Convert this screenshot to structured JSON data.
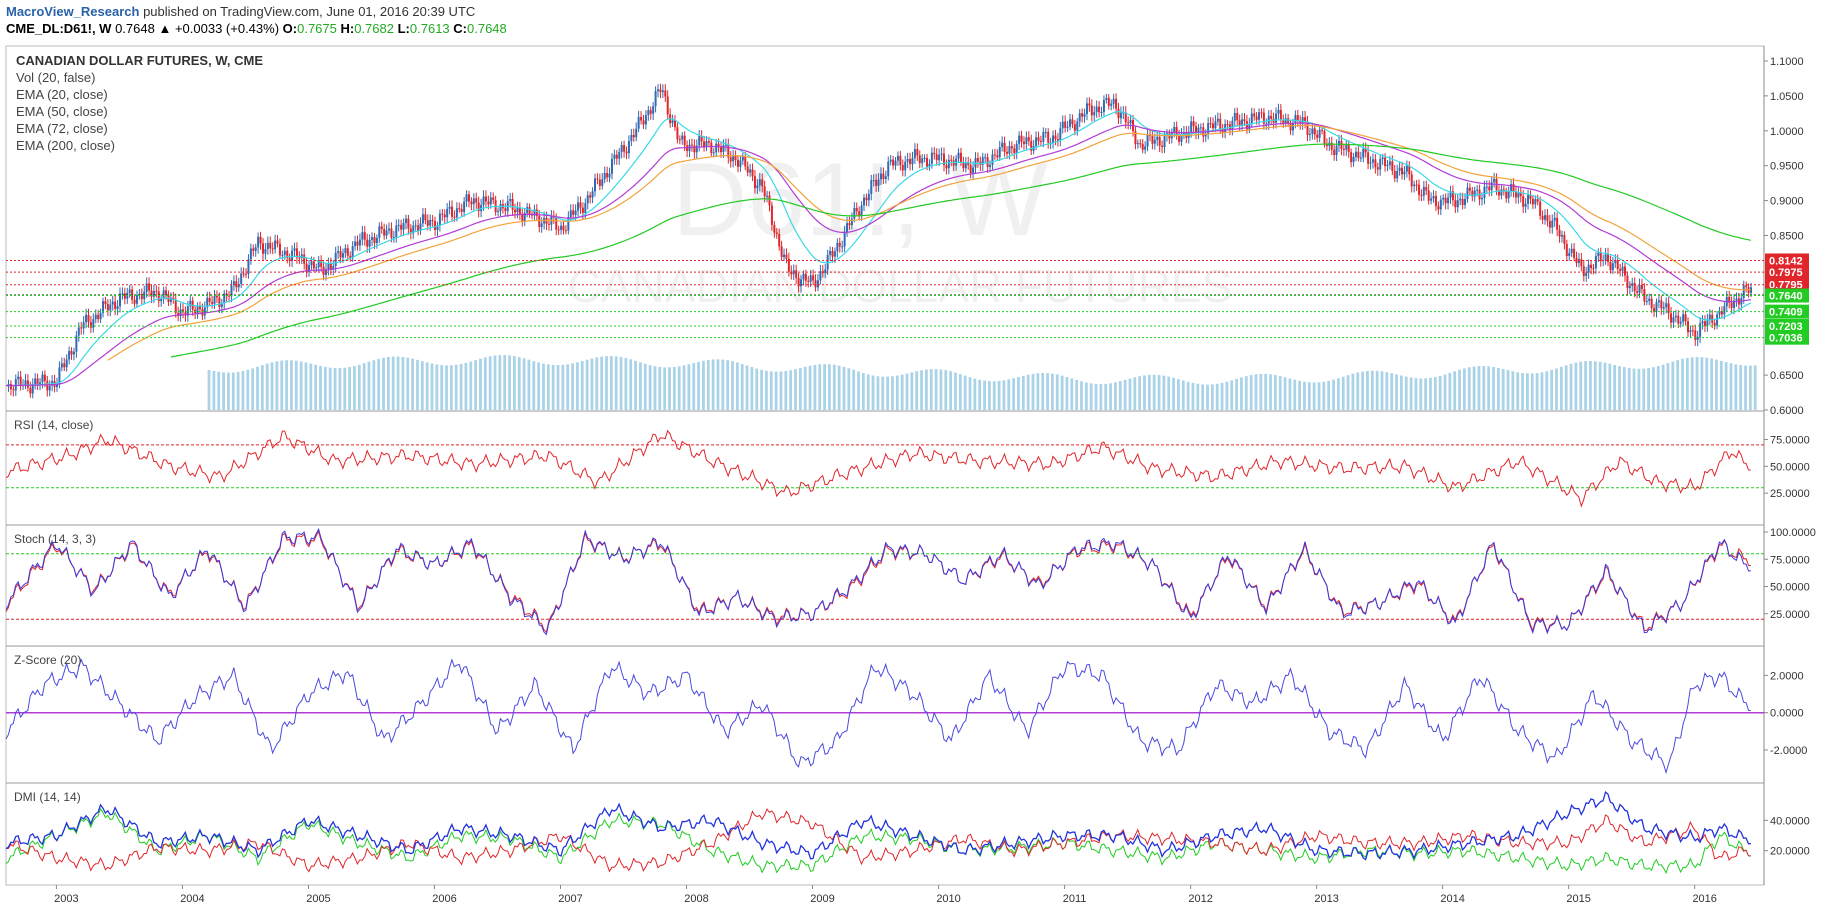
{
  "header": {
    "author": "MacroView_Research",
    "published": "published on TradingView.com, June 01, 2016 20:39 UTC",
    "symbol": "CME_DL:D61!, W",
    "last": "0.7648",
    "change": "▲ +0.0033 (+0.43%)",
    "o_label": "O:",
    "o_value": "0.7675",
    "h_label": "H:",
    "h_value": "0.7682",
    "l_label": "L:",
    "l_value": "0.7613",
    "c_label": "C:",
    "c_value": "0.7648"
  },
  "legend": {
    "title": "CANADIAN DOLLAR FUTURES, W, CME",
    "items": [
      "Vol (20, false)",
      "EMA (20, close)",
      "EMA (50, close)",
      "EMA (72, close)",
      "EMA (200, close)"
    ]
  },
  "watermark": {
    "symbol": "D61!, W",
    "name": "CANADIAN DOLLAR FUTURES"
  },
  "colors": {
    "candle_up": "#2f6ab3",
    "candle_down": "#e0262b",
    "ema20": "#3ad8e8",
    "ema50": "#b23bd6",
    "ema72": "#f2a33a",
    "ema200": "#22c922",
    "volume": "#8fc4e0",
    "resistance": "#e0262b",
    "support": "#22cc22",
    "rsi": "#e0262b",
    "stoch_k": "#3a3ae0",
    "stoch_d": "#e0262b",
    "zscore": "#4a4ae0",
    "zero_line": "#b23bd6",
    "dmi_plus": "#22cc22",
    "dmi_minus": "#e0262b",
    "adx": "#2233dd"
  },
  "chart_data": [
    {
      "type": "line",
      "panel": "price",
      "title": "CANADIAN DOLLAR FUTURES, W, CME",
      "ylim": [
        0.6,
        1.11
      ],
      "yticks": [
        "1.1000",
        "1.0500",
        "1.0000",
        "0.9500",
        "0.9000",
        "0.8500",
        "0.6500",
        "0.6000"
      ],
      "x_labels": [
        "2003",
        "2004",
        "2005",
        "2006",
        "2007",
        "2008",
        "2009",
        "2010",
        "2011",
        "2012",
        "2013",
        "2014",
        "2015",
        "2016"
      ],
      "series": [
        {
          "x": [
            2002.6,
            2003.0,
            2003.2,
            2003.5,
            2003.8,
            2004.0,
            2004.2,
            2004.4,
            2004.6,
            2004.9,
            2005.1,
            2005.4,
            2005.7,
            2006.0,
            2006.3,
            2006.6,
            2006.9,
            2007.0,
            2007.2,
            2007.4,
            2007.6,
            2007.8,
            2007.95,
            2008.2,
            2008.4,
            2008.6,
            2008.8,
            2009.0,
            2009.15,
            2009.4,
            2009.6,
            2009.8,
            2010.0,
            2010.3,
            2010.6,
            2010.9,
            2011.2,
            2011.4,
            2011.6,
            2011.8,
            2012.0,
            2012.3,
            2012.6,
            2012.9,
            2013.1,
            2013.4,
            2013.7,
            2013.9,
            2014.1,
            2014.4,
            2014.7,
            2014.9,
            2015.1,
            2015.3,
            2015.6,
            2015.8,
            2016.0,
            2016.2,
            2016.4
          ],
          "values": [
            0.635,
            0.64,
            0.72,
            0.76,
            0.77,
            0.74,
            0.75,
            0.77,
            0.84,
            0.82,
            0.8,
            0.84,
            0.86,
            0.87,
            0.9,
            0.89,
            0.87,
            0.86,
            0.9,
            0.95,
            1.0,
            1.06,
            0.98,
            0.98,
            0.96,
            0.92,
            0.8,
            0.78,
            0.82,
            0.9,
            0.95,
            0.96,
            0.96,
            0.95,
            0.98,
            0.99,
            1.03,
            1.04,
            0.98,
            0.99,
            1.0,
            1.01,
            1.02,
            1.01,
            0.98,
            0.96,
            0.94,
            0.9,
            0.9,
            0.92,
            0.9,
            0.86,
            0.8,
            0.82,
            0.76,
            0.74,
            0.71,
            0.74,
            0.77
          ]
        }
      ],
      "resistance_levels": [
        "0.8142",
        "0.7975",
        "0.7795"
      ],
      "current_level": "0.7648",
      "support_levels": [
        "0.7640",
        "0.7409",
        "0.7203",
        "0.7036"
      ]
    },
    {
      "type": "line",
      "panel": "rsi",
      "title": "RSI (14, close)",
      "yticks": [
        "75.0000",
        "50.0000",
        "25.0000"
      ],
      "ylim": [
        0,
        95
      ],
      "x": [
        2002.6,
        2003.1,
        2003.4,
        2003.9,
        2004.3,
        2004.8,
        2005.2,
        2005.8,
        2006.3,
        2006.9,
        2007.3,
        2007.8,
        2008.2,
        2008.8,
        2009.3,
        2009.8,
        2010.3,
        2010.9,
        2011.3,
        2011.7,
        2012.2,
        2012.7,
        2013.2,
        2013.7,
        2014.1,
        2014.6,
        2015.1,
        2015.4,
        2015.7,
        2016.0,
        2016.3,
        2016.4
      ],
      "values": [
        45,
        60,
        75,
        50,
        40,
        78,
        55,
        60,
        52,
        60,
        35,
        80,
        55,
        25,
        45,
        62,
        55,
        52,
        68,
        48,
        40,
        55,
        48,
        50,
        30,
        55,
        20,
        55,
        35,
        30,
        65,
        52
      ],
      "overbought": 70,
      "oversold": 30
    },
    {
      "type": "line",
      "panel": "stoch",
      "title": "Stoch (14, 3, 3)",
      "yticks": [
        "100.0000",
        "75.0000",
        "50.0000",
        "25.0000"
      ],
      "ylim": [
        0,
        100
      ],
      "x": [
        2002.6,
        2003.0,
        2003.3,
        2003.6,
        2003.9,
        2004.2,
        2004.5,
        2004.8,
        2005.1,
        2005.4,
        2005.7,
        2006.0,
        2006.3,
        2006.6,
        2006.9,
        2007.2,
        2007.5,
        2007.8,
        2008.1,
        2008.4,
        2008.7,
        2009.0,
        2009.3,
        2009.6,
        2009.9,
        2010.2,
        2010.5,
        2010.8,
        2011.1,
        2011.4,
        2011.7,
        2012.0,
        2012.3,
        2012.6,
        2012.9,
        2013.2,
        2013.5,
        2013.8,
        2014.1,
        2014.4,
        2014.7,
        2015.0,
        2015.3,
        2015.6,
        2015.9,
        2016.2,
        2016.4
      ],
      "values": [
        35,
        90,
        45,
        90,
        40,
        85,
        30,
        95,
        95,
        30,
        85,
        70,
        90,
        40,
        10,
        95,
        75,
        92,
        25,
        40,
        20,
        25,
        50,
        85,
        80,
        55,
        80,
        50,
        85,
        90,
        70,
        20,
        80,
        30,
        85,
        25,
        35,
        55,
        15,
        90,
        15,
        15,
        65,
        10,
        35,
        90,
        70
      ],
      "signal_x": [
        2002.6,
        2003.0,
        2003.3,
        2003.6,
        2003.9,
        2004.2,
        2004.5,
        2004.8,
        2005.1,
        2005.4,
        2005.7,
        2006.0,
        2006.3,
        2006.6,
        2006.9,
        2007.2,
        2007.5,
        2007.8,
        2008.1,
        2008.4,
        2008.7,
        2009.0,
        2009.3,
        2009.6,
        2009.9,
        2010.2,
        2010.5,
        2010.8,
        2011.1,
        2011.4,
        2011.7,
        2012.0,
        2012.3,
        2012.6,
        2012.9,
        2013.2,
        2013.5,
        2013.8,
        2014.1,
        2014.4,
        2014.7,
        2015.0,
        2015.3,
        2015.6,
        2015.9,
        2016.2,
        2016.4
      ],
      "signal_values": [
        33,
        88,
        47,
        88,
        42,
        83,
        32,
        93,
        93,
        32,
        83,
        70,
        88,
        42,
        12,
        93,
        76,
        90,
        27,
        40,
        22,
        25,
        48,
        83,
        80,
        55,
        78,
        52,
        83,
        88,
        70,
        22,
        78,
        32,
        83,
        27,
        35,
        53,
        17,
        88,
        17,
        15,
        63,
        12,
        35,
        88,
        75
      ],
      "upper": 80,
      "lower": 20
    },
    {
      "type": "line",
      "panel": "zscore",
      "title": "Z-Score (20)",
      "yticks": [
        "2.0000",
        "0.0000",
        "-2.0000"
      ],
      "ylim": [
        -3.5,
        3.2
      ],
      "x": [
        2002.6,
        2002.9,
        2003.2,
        2003.5,
        2003.8,
        2004.1,
        2004.4,
        2004.7,
        2005.0,
        2005.3,
        2005.6,
        2005.9,
        2006.2,
        2006.5,
        2006.8,
        2007.1,
        2007.4,
        2007.7,
        2008.0,
        2008.3,
        2008.6,
        2008.9,
        2009.2,
        2009.5,
        2009.8,
        2010.1,
        2010.4,
        2010.7,
        2011.0,
        2011.3,
        2011.6,
        2011.9,
        2012.2,
        2012.5,
        2012.8,
        2013.1,
        2013.4,
        2013.7,
        2014.0,
        2014.3,
        2014.6,
        2014.9,
        2015.2,
        2015.5,
        2015.8,
        2016.0,
        2016.2,
        2016.4
      ],
      "values": [
        -1.0,
        1.5,
        2.5,
        0.5,
        -1.5,
        0.8,
        2.0,
        -2.0,
        1.0,
        2.2,
        -1.5,
        0.5,
        2.8,
        -1.0,
        1.5,
        -2.0,
        2.5,
        1.0,
        2.0,
        -1.0,
        0.5,
        -2.8,
        -1.5,
        2.5,
        1.0,
        -1.5,
        2.0,
        -1.0,
        2.5,
        2.0,
        -1.5,
        -2.0,
        1.5,
        0.5,
        2.0,
        -1.0,
        -2.0,
        1.5,
        -1.5,
        2.0,
        -1.0,
        -2.5,
        1.0,
        -1.5,
        -2.8,
        1.5,
        2.0,
        0.5
      ]
    },
    {
      "type": "line",
      "panel": "dmi",
      "title": "DMI (14, 14)",
      "yticks": [
        "40.0000",
        "20.0000"
      ],
      "ylim": [
        0,
        60
      ],
      "x": [
        2002.6,
        2003.0,
        2003.4,
        2003.8,
        2004.2,
        2004.6,
        2005.0,
        2005.4,
        2005.8,
        2006.2,
        2006.6,
        2007.0,
        2007.4,
        2007.8,
        2008.2,
        2008.6,
        2009.0,
        2009.4,
        2009.8,
        2010.2,
        2010.6,
        2011.0,
        2011.4,
        2011.8,
        2012.2,
        2012.6,
        2013.0,
        2013.4,
        2013.8,
        2014.2,
        2014.6,
        2015.0,
        2015.3,
        2015.6,
        2016.0,
        2016.2,
        2016.4
      ],
      "adx": [
        25,
        30,
        48,
        25,
        30,
        20,
        40,
        30,
        20,
        35,
        30,
        20,
        48,
        35,
        40,
        25,
        18,
        40,
        30,
        20,
        25,
        30,
        30,
        20,
        30,
        35,
        20,
        18,
        20,
        25,
        30,
        45,
        55,
        35,
        28,
        35,
        28
      ],
      "di_plus": [
        15,
        30,
        45,
        20,
        30,
        15,
        38,
        25,
        15,
        30,
        28,
        15,
        40,
        38,
        20,
        10,
        10,
        30,
        28,
        20,
        22,
        25,
        20,
        15,
        25,
        20,
        15,
        20,
        18,
        20,
        15,
        10,
        15,
        10,
        10,
        30,
        20
      ],
      "di_minus": [
        25,
        15,
        10,
        22,
        20,
        25,
        10,
        15,
        25,
        15,
        20,
        30,
        10,
        12,
        25,
        45,
        38,
        15,
        20,
        28,
        20,
        25,
        30,
        28,
        25,
        20,
        30,
        25,
        25,
        30,
        25,
        25,
        40,
        25,
        35,
        15,
        20
      ]
    }
  ]
}
